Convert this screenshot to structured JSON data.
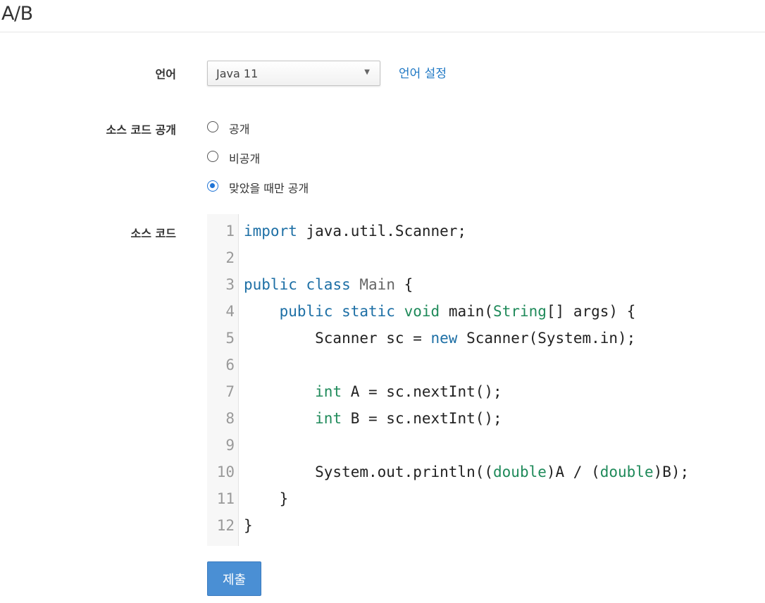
{
  "header": {
    "title": "A/B"
  },
  "form": {
    "language_label": "언어",
    "language_selected": "Java 11",
    "language_settings_link": "언어 설정",
    "visibility_label": "소스 코드 공개",
    "visibility_options": [
      {
        "label": "공개",
        "checked": false
      },
      {
        "label": "비공개",
        "checked": false
      },
      {
        "label": "맞았을 때만 공개",
        "checked": true
      }
    ],
    "source_label": "소스 코드",
    "submit_label": "제출"
  },
  "editor": {
    "line_numbers": [
      "1",
      "2",
      "3",
      "4",
      "5",
      "6",
      "7",
      "8",
      "9",
      "10",
      "11",
      "12"
    ],
    "lines": [
      [
        {
          "t": "import",
          "c": "kw"
        },
        {
          "t": " java.util.Scanner;"
        }
      ],
      [],
      [
        {
          "t": "public",
          "c": "kw"
        },
        {
          "t": " "
        },
        {
          "t": "class",
          "c": "kw"
        },
        {
          "t": " "
        },
        {
          "t": "Main",
          "c": "cls"
        },
        {
          "t": " {"
        }
      ],
      [
        {
          "t": "    "
        },
        {
          "t": "public",
          "c": "kw"
        },
        {
          "t": " "
        },
        {
          "t": "static",
          "c": "kw"
        },
        {
          "t": " "
        },
        {
          "t": "void",
          "c": "ty"
        },
        {
          "t": " main("
        },
        {
          "t": "String",
          "c": "ty"
        },
        {
          "t": "[] args) {"
        }
      ],
      [
        {
          "t": "        Scanner sc = "
        },
        {
          "t": "new",
          "c": "kw"
        },
        {
          "t": " Scanner(System.in);"
        }
      ],
      [],
      [
        {
          "t": "        "
        },
        {
          "t": "int",
          "c": "ty"
        },
        {
          "t": " A = sc.nextInt();"
        }
      ],
      [
        {
          "t": "        "
        },
        {
          "t": "int",
          "c": "ty"
        },
        {
          "t": " B = sc.nextInt();"
        }
      ],
      [],
      [
        {
          "t": "        System.out.println(("
        },
        {
          "t": "double",
          "c": "ty"
        },
        {
          "t": ")A / ("
        },
        {
          "t": "double",
          "c": "ty"
        },
        {
          "t": ")B);"
        }
      ],
      [
        {
          "t": "    }"
        }
      ],
      [
        {
          "t": "}"
        }
      ]
    ]
  }
}
